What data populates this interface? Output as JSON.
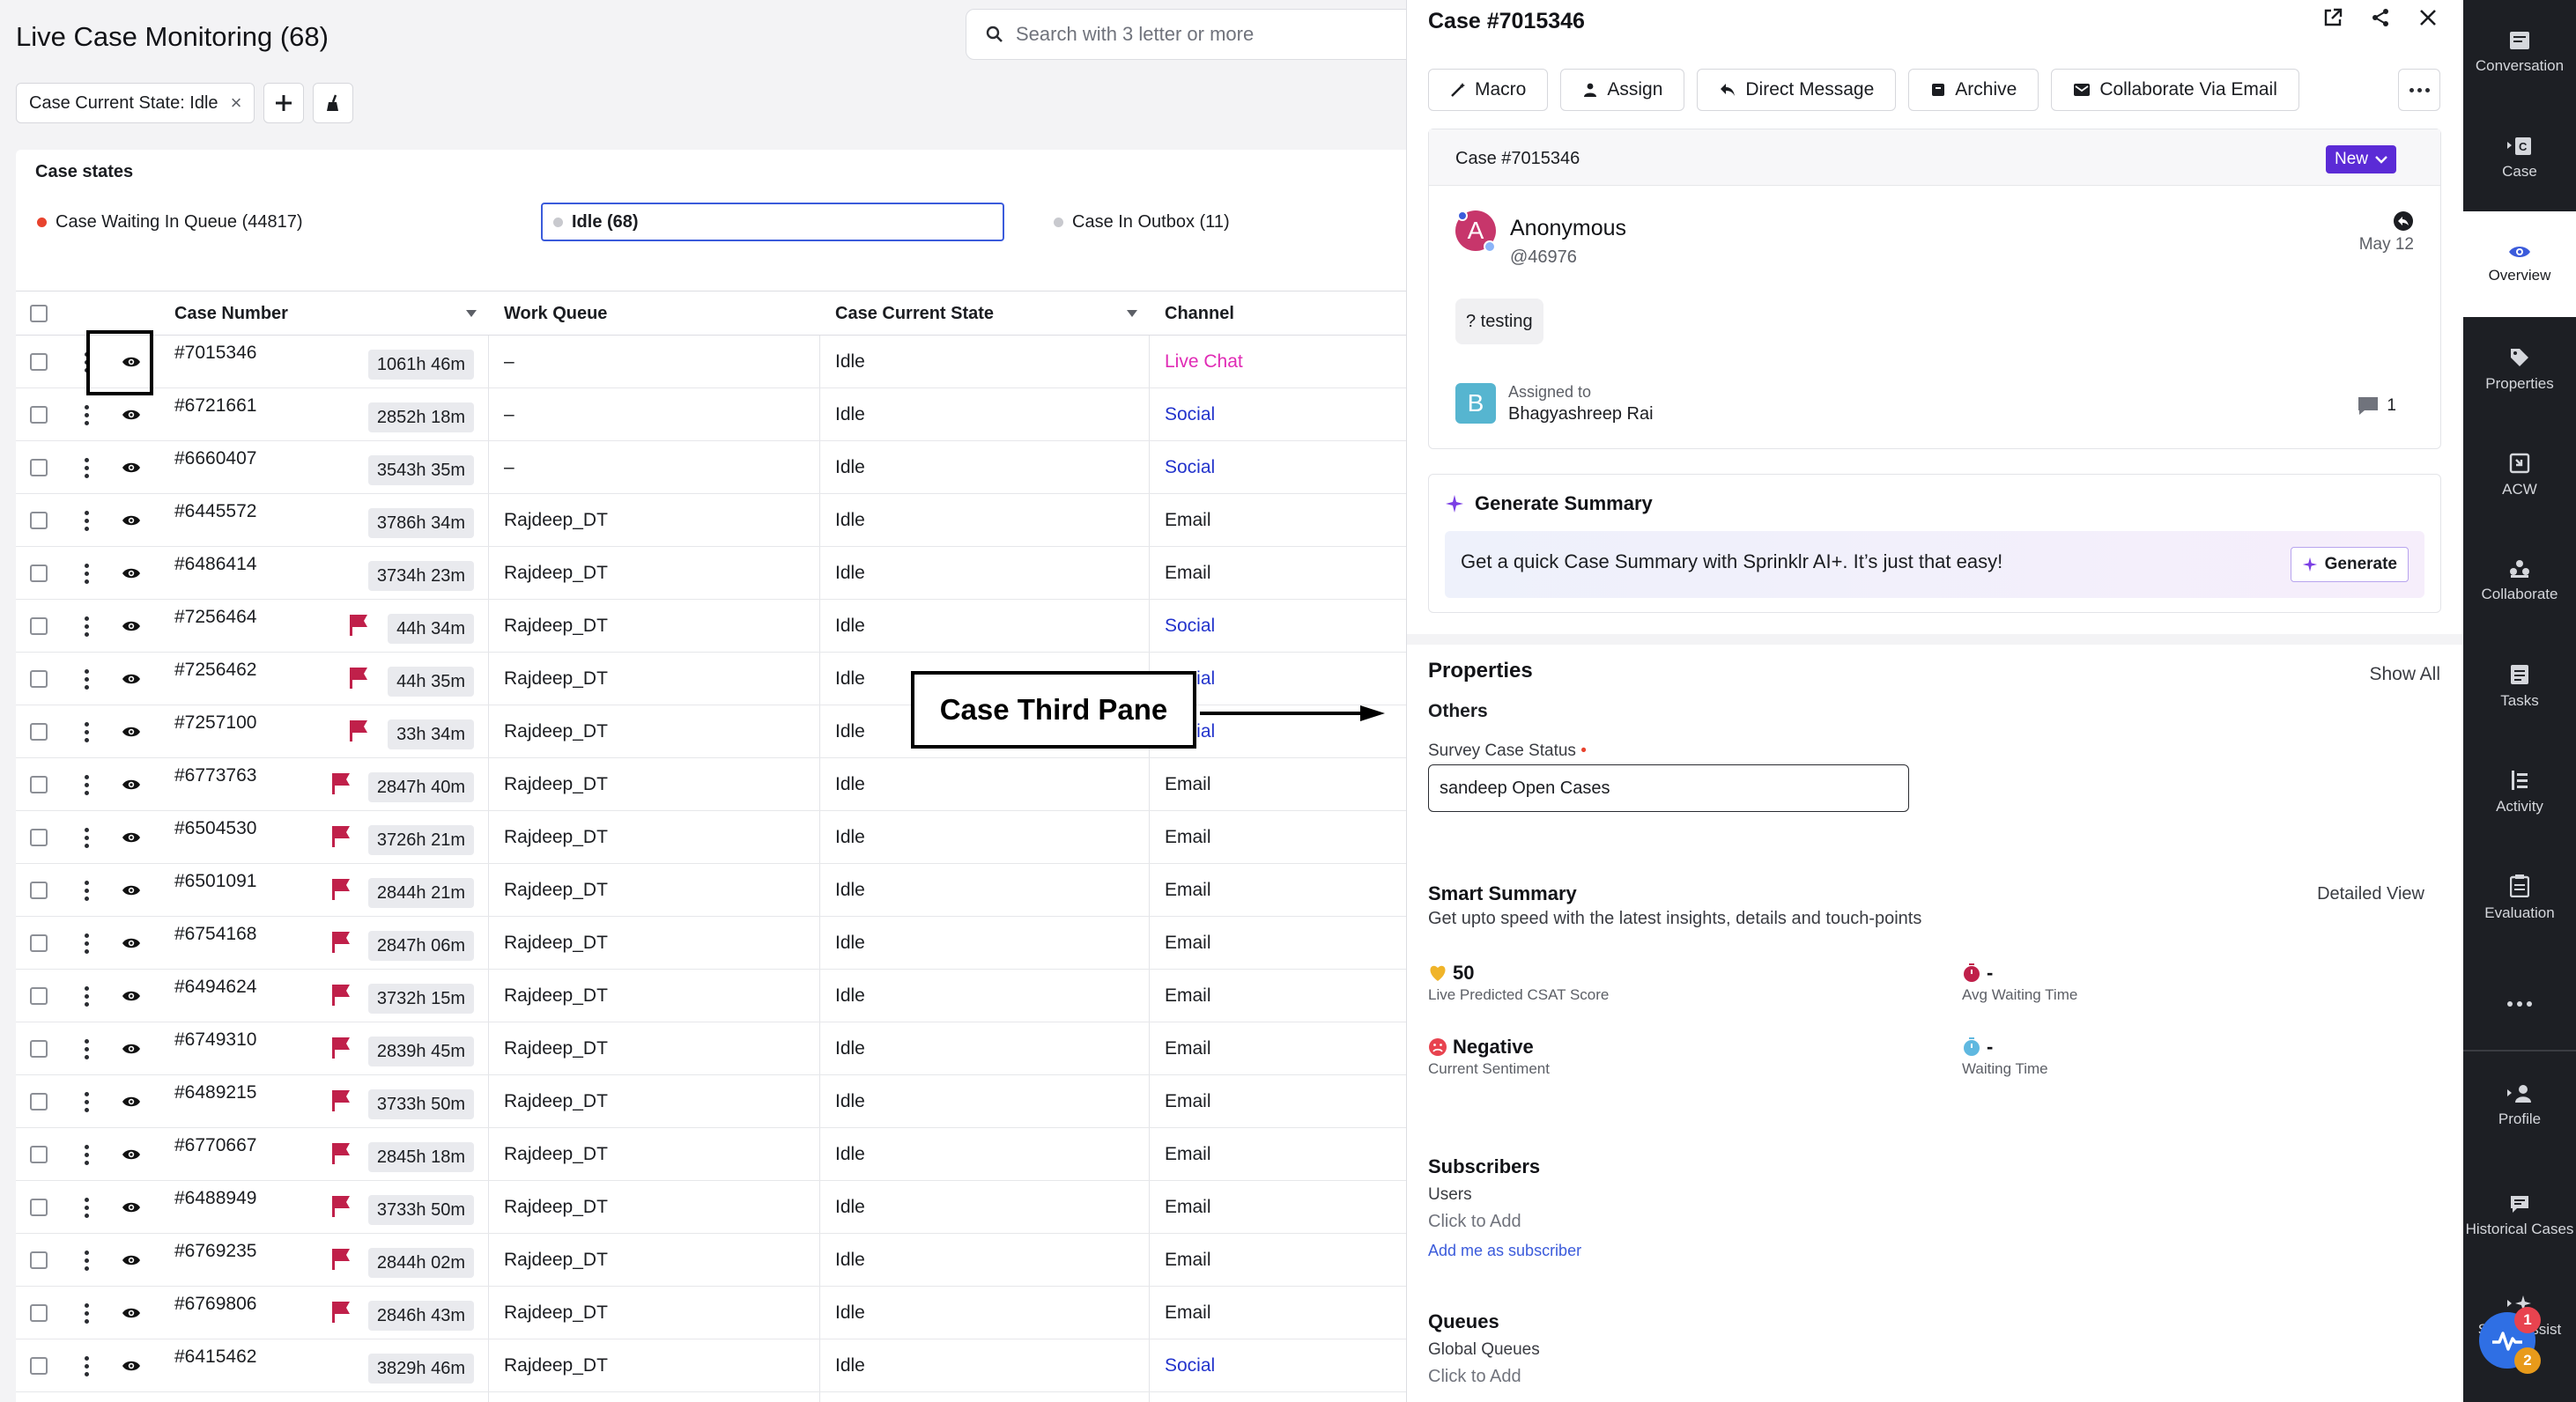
{
  "page": {
    "title": "Live Case Monitoring (68)",
    "search_placeholder": "Search with 3 letter or more"
  },
  "filters": {
    "chip_label": "Case Current State: Idle",
    "chip_remove": "×"
  },
  "case_states": {
    "title": "Case states",
    "items": [
      {
        "label": "Case Waiting In Queue (44817)",
        "color": "#e8432e"
      },
      {
        "label": "Idle (68)",
        "color": "#c8c9ce"
      },
      {
        "label": "Case In Outbox (11)",
        "color": "#c8c9ce"
      }
    ]
  },
  "table": {
    "columns": [
      "Case Number",
      "Work Queue",
      "Case Current State",
      "Channel"
    ],
    "rows": [
      {
        "case": "#7015346",
        "time": "1061h 46m",
        "queue": "–",
        "state": "Idle",
        "channel": "Live Chat",
        "flag": false
      },
      {
        "case": "#6721661",
        "time": "2852h 18m",
        "queue": "–",
        "state": "Idle",
        "channel": "Social",
        "flag": false
      },
      {
        "case": "#6660407",
        "time": "3543h 35m",
        "queue": "–",
        "state": "Idle",
        "channel": "Social",
        "flag": false
      },
      {
        "case": "#6445572",
        "time": "3786h 34m",
        "queue": "Rajdeep_DT",
        "state": "Idle",
        "channel": "Email",
        "flag": false
      },
      {
        "case": "#6486414",
        "time": "3734h 23m",
        "queue": "Rajdeep_DT",
        "state": "Idle",
        "channel": "Email",
        "flag": false
      },
      {
        "case": "#7256464",
        "time": "44h 34m",
        "queue": "Rajdeep_DT",
        "state": "Idle",
        "channel": "Social",
        "flag": true
      },
      {
        "case": "#7256462",
        "time": "44h 35m",
        "queue": "Rajdeep_DT",
        "state": "Idle",
        "channel": "Social",
        "flag": true
      },
      {
        "case": "#7257100",
        "time": "33h 34m",
        "queue": "Rajdeep_DT",
        "state": "Idle",
        "channel": "Social",
        "flag": true
      },
      {
        "case": "#6773763",
        "time": "2847h 40m",
        "queue": "Rajdeep_DT",
        "state": "Idle",
        "channel": "Email",
        "flag": true
      },
      {
        "case": "#6504530",
        "time": "3726h 21m",
        "queue": "Rajdeep_DT",
        "state": "Idle",
        "channel": "Email",
        "flag": true
      },
      {
        "case": "#6501091",
        "time": "2844h 21m",
        "queue": "Rajdeep_DT",
        "state": "Idle",
        "channel": "Email",
        "flag": true
      },
      {
        "case": "#6754168",
        "time": "2847h 06m",
        "queue": "Rajdeep_DT",
        "state": "Idle",
        "channel": "Email",
        "flag": true
      },
      {
        "case": "#6494624",
        "time": "3732h 15m",
        "queue": "Rajdeep_DT",
        "state": "Idle",
        "channel": "Email",
        "flag": true
      },
      {
        "case": "#6749310",
        "time": "2839h 45m",
        "queue": "Rajdeep_DT",
        "state": "Idle",
        "channel": "Email",
        "flag": true
      },
      {
        "case": "#6489215",
        "time": "3733h 50m",
        "queue": "Rajdeep_DT",
        "state": "Idle",
        "channel": "Email",
        "flag": true
      },
      {
        "case": "#6770667",
        "time": "2845h 18m",
        "queue": "Rajdeep_DT",
        "state": "Idle",
        "channel": "Email",
        "flag": true
      },
      {
        "case": "#6488949",
        "time": "3733h 50m",
        "queue": "Rajdeep_DT",
        "state": "Idle",
        "channel": "Email",
        "flag": true
      },
      {
        "case": "#6769235",
        "time": "2844h 02m",
        "queue": "Rajdeep_DT",
        "state": "Idle",
        "channel": "Email",
        "flag": true
      },
      {
        "case": "#6769806",
        "time": "2846h 43m",
        "queue": "Rajdeep_DT",
        "state": "Idle",
        "channel": "Email",
        "flag": true
      },
      {
        "case": "#6415462",
        "time": "3829h 46m",
        "queue": "Rajdeep_DT",
        "state": "Idle",
        "channel": "Social",
        "flag": false
      }
    ]
  },
  "annotation": {
    "callout": "Case Third Pane"
  },
  "pane": {
    "title": "Case #7015346",
    "actions": [
      "Macro",
      "Assign",
      "Direct Message",
      "Archive",
      "Collaborate Via Email"
    ],
    "card": {
      "case_title": "Case #7015346",
      "status": "New",
      "customer_initial": "A",
      "customer_name": "Anonymous",
      "customer_handle": "@46976",
      "date": "May 12",
      "message": "? testing",
      "assignee_initial": "B",
      "assigned_label": "Assigned to",
      "assignee": "Bhagyashreep Rai",
      "comment_count": "1"
    },
    "generate": {
      "title": "Generate Summary",
      "text": "Get a quick Case Summary with Sprinklr AI+. It’s just that easy!",
      "button": "Generate"
    },
    "properties": {
      "title": "Properties",
      "show_all": "Show All",
      "group": "Others",
      "field_label": "Survey Case Status",
      "required_mark": "•",
      "field_value": "sandeep Open Cases"
    },
    "smart_summary": {
      "title": "Smart Summary",
      "detailed": "Detailed View",
      "subtitle": "Get upto speed with the latest insights, details and touch-points",
      "metrics": [
        {
          "value": "50",
          "label": "Live Predicted CSAT Score"
        },
        {
          "value": "-",
          "label": "Avg Waiting Time"
        },
        {
          "value": "Negative",
          "label": "Current Sentiment"
        },
        {
          "value": "-",
          "label": "Waiting Time"
        }
      ]
    },
    "subscribers": {
      "title": "Subscribers",
      "users_label": "Users",
      "click_to_add": "Click to Add",
      "add_me": "Add me as subscriber"
    },
    "queues": {
      "title": "Queues",
      "global_label": "Global Queues",
      "click_to_add": "Click to Add"
    }
  },
  "rail": {
    "items": [
      "Conversation",
      "Case",
      "Overview",
      "Properties",
      "ACW",
      "Collaborate",
      "Tasks",
      "Activity",
      "Evaluation",
      "Profile",
      "Historical Cases",
      "Smart Assist"
    ],
    "badge_red": "1",
    "badge_yellow": "2"
  },
  "colors": {
    "accent": "#5b2bd6",
    "link_social": "#2233cc",
    "live_chat": "#e02bb5",
    "flag": "#c0204a",
    "rail_bg": "#1d1f24"
  }
}
